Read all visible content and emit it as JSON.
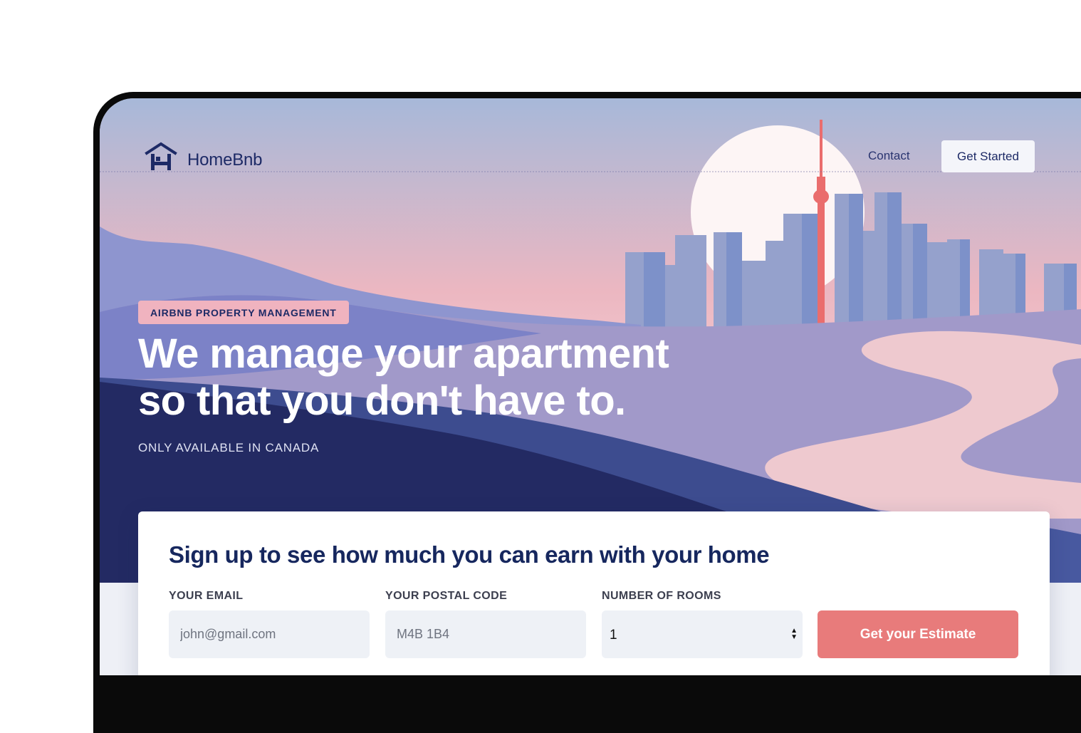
{
  "brand": {
    "name": "HomeBnb",
    "logo_icon": "house-icon"
  },
  "nav": {
    "contact_label": "Contact",
    "cta_label": "Get Started"
  },
  "hero": {
    "badge": "AIRBNB PROPERTY MANAGEMENT",
    "headline_line1": "We manage your apartment",
    "headline_line2": "so that you don't have to.",
    "subnote": "ONLY AVAILABLE IN CANADA"
  },
  "signup": {
    "title": "Sign up to see how much you can earn with your home",
    "email": {
      "label": "YOUR EMAIL",
      "placeholder": "john@gmail.com",
      "value": ""
    },
    "postal": {
      "label": "YOUR POSTAL CODE",
      "placeholder": "M4B 1B4",
      "value": ""
    },
    "rooms": {
      "label": "NUMBER OF ROOMS",
      "value": "1"
    },
    "submit_label": "Get your Estimate"
  },
  "colors": {
    "brand_navy": "#1d2a66",
    "badge_pink": "#f0b3bf",
    "cta_coral": "#e87b7b",
    "tower_red": "#ea6d6d",
    "field_bg": "#eef1f6"
  }
}
